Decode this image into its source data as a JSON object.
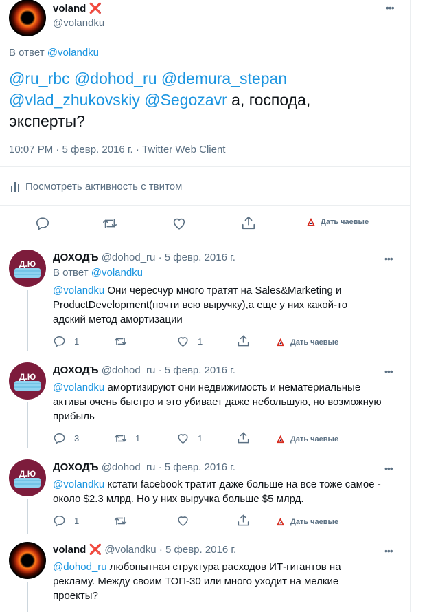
{
  "main_tweet": {
    "author_name": "voland",
    "author_badge": "❌",
    "author_handle": "@volandku",
    "reply_prefix": "В ответ",
    "reply_to": "@volandku",
    "mentions": [
      "@ru_rbc",
      "@dohod_ru",
      "@demura_stepan",
      "@vlad_zhukovskiy",
      "@Segozavr"
    ],
    "text": "а, господа, эксперты?",
    "timestamp": "10:07 PM · 5 февр. 2016 г. · Twitter Web Client",
    "activity_label": "Посмотреть активность с твитом",
    "tip_label": "Дать чаевые"
  },
  "replies": [
    {
      "author_name": "ДОХОДЪ",
      "author_handle": "@dohod_ru",
      "date": "5 февр. 2016 г.",
      "reply_prefix": "В ответ",
      "reply_to": "@volandku",
      "mention": "@volandku",
      "text": "Они чересчур много тратят на Sales&Marketing и ProductDevelopment(почти всю выручку),а еще у них какой-то адский метод амортизации",
      "reply_count": "1",
      "retweet_count": "",
      "like_count": "1",
      "tip_label": "Дать чаевые"
    },
    {
      "author_name": "ДОХОДЪ",
      "author_handle": "@dohod_ru",
      "date": "5 февр. 2016 г.",
      "mention": "@volandku",
      "text": "амортизируют они недвижимость и нематериальные активы очень быстро и это убивает даже небольшую, но возможную прибыль",
      "reply_count": "3",
      "retweet_count": "1",
      "like_count": "1",
      "tip_label": "Дать чаевые"
    },
    {
      "author_name": "ДОХОДЪ",
      "author_handle": "@dohod_ru",
      "date": "5 февр. 2016 г.",
      "mention": "@volandku",
      "text": "кстати facebook тратит даже больше на все тоже самое - около $2.3 млрд. Но у них выручка больше $5 млрд.",
      "reply_count": "1",
      "retweet_count": "",
      "like_count": "",
      "tip_label": "Дать чаевые"
    },
    {
      "author_name": "voland",
      "author_badge": "❌",
      "author_handle": "@volandku",
      "date": "5 февр. 2016 г.",
      "mention": "@dohod_ru",
      "text": "любопытная структура расходов ИТ-гигантов на рекламу. Между своим ТОП-30 или много уходит на мелкие проекты?"
    }
  ],
  "separator": "·",
  "icons": [
    "more-icon",
    "reply-icon",
    "retweet-icon",
    "like-icon",
    "share-icon",
    "tip-icon",
    "activity-icon"
  ],
  "colors": {
    "link": "#1b95e0",
    "muted": "#5b7083",
    "badge": "#e0245e",
    "tip": "#d62d20"
  }
}
